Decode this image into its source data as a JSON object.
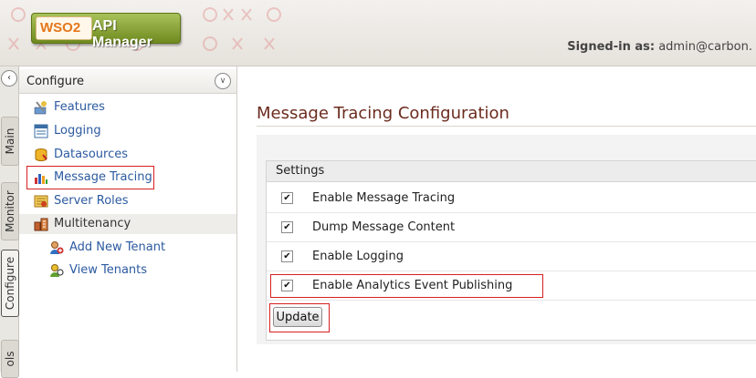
{
  "header": {
    "logo_brand": "WSO2",
    "logo_product": "API Manager",
    "signed_in_label": "Signed-in as:",
    "signed_in_user": "admin@carbon."
  },
  "vertical_tabs": {
    "collapse_icon": "chevron-left-icon",
    "items": [
      {
        "label": "Main",
        "active": false
      },
      {
        "label": "Monitor",
        "active": false
      },
      {
        "label": "Configure",
        "active": true
      },
      {
        "label": "ols",
        "active": false
      }
    ]
  },
  "menu": {
    "title": "Configure",
    "items": [
      {
        "label": "Features",
        "icon": "features-icon"
      },
      {
        "label": "Logging",
        "icon": "logging-icon"
      },
      {
        "label": "Datasources",
        "icon": "datasources-icon"
      },
      {
        "label": "Message Tracing",
        "icon": "message-tracing-icon"
      },
      {
        "label": "Server Roles",
        "icon": "server-roles-icon"
      },
      {
        "label": "Multitenancy",
        "icon": "multitenancy-icon"
      },
      {
        "label": "Add New Tenant",
        "icon": "add-tenant-icon"
      },
      {
        "label": "View Tenants",
        "icon": "view-tenants-icon"
      }
    ]
  },
  "content": {
    "title": "Message Tracing Configuration",
    "settings_header": "Settings",
    "settings": [
      {
        "label": "Enable Message Tracing",
        "checked": true
      },
      {
        "label": "Dump Message Content",
        "checked": true
      },
      {
        "label": "Enable Logging",
        "checked": true
      },
      {
        "label": "Enable Analytics Event Publishing",
        "checked": true
      }
    ],
    "update_label": "Update"
  },
  "colors": {
    "title": "#6b2c1e",
    "link": "#2c5aa0",
    "highlight": "#d62020",
    "logo_green": "#7f9a2a"
  }
}
